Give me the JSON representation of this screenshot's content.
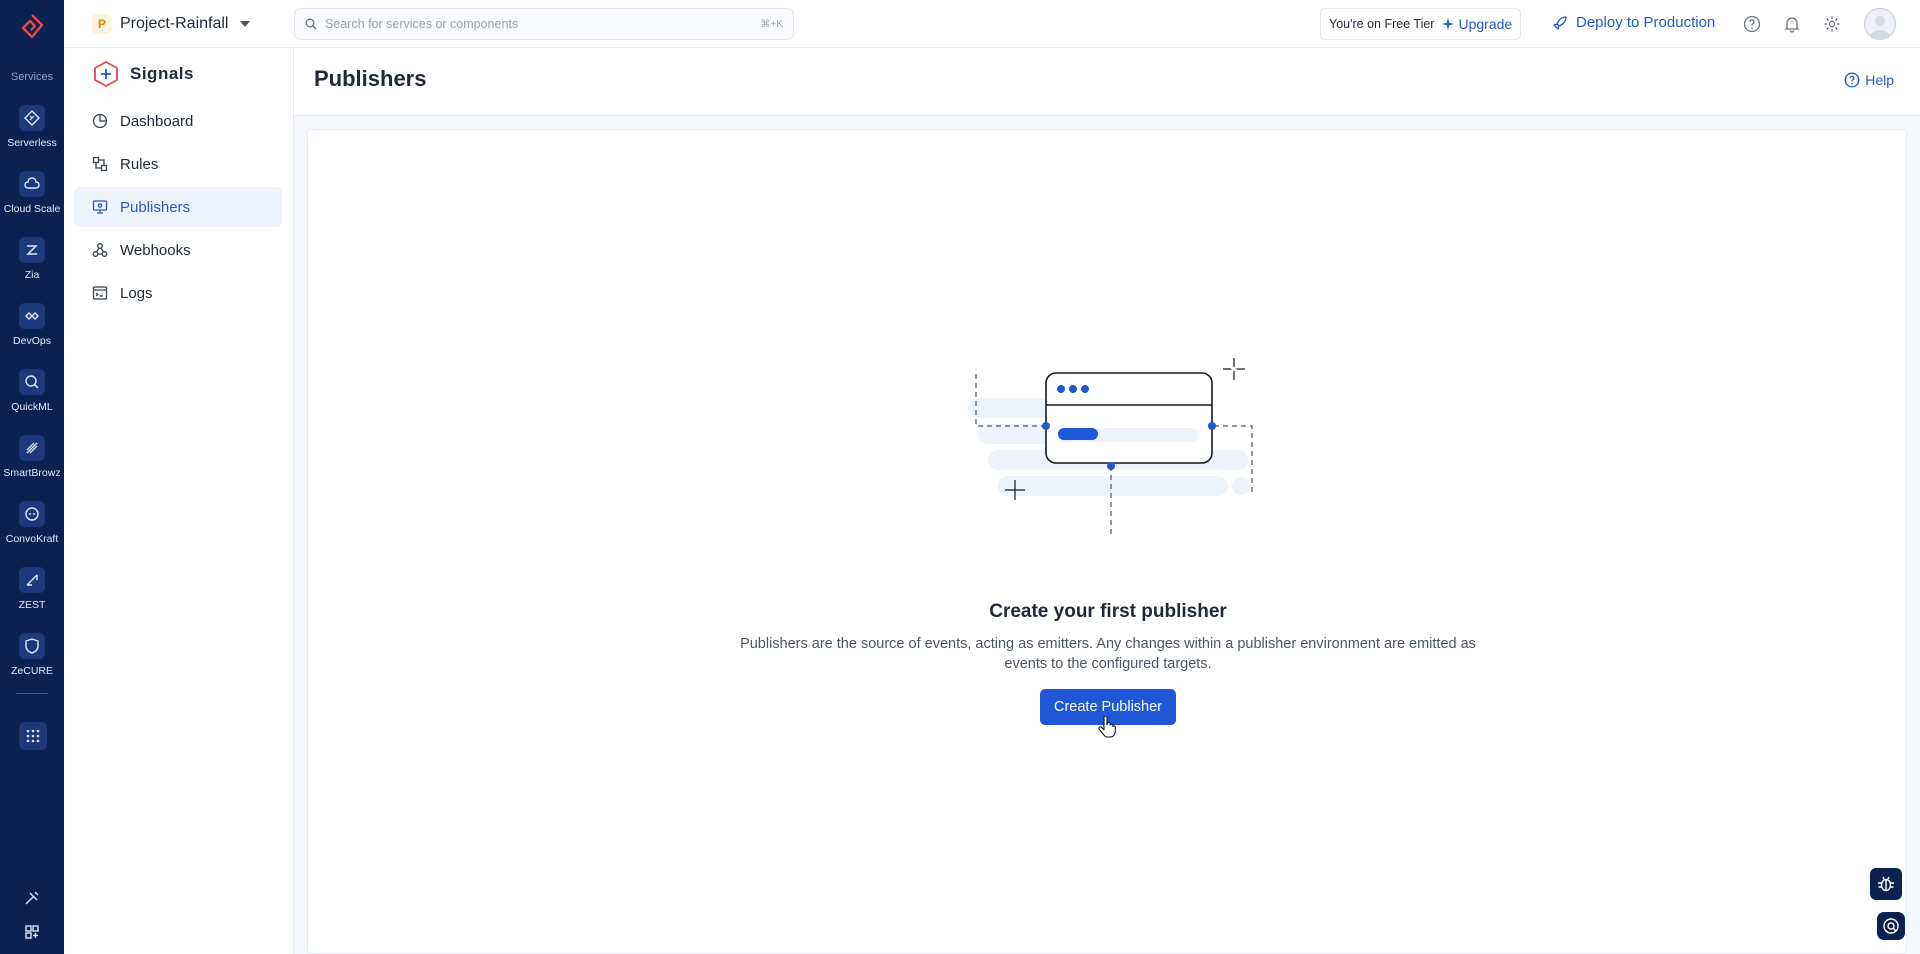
{
  "rail": {
    "section_label": "Services",
    "items": [
      {
        "label": "Serverless",
        "icon": "serverless-icon"
      },
      {
        "label": "Cloud Scale",
        "icon": "cloud-scale-icon"
      },
      {
        "label": "Zia",
        "icon": "zia-icon"
      },
      {
        "label": "DevOps",
        "icon": "devops-icon"
      },
      {
        "label": "QuickML",
        "icon": "quickml-icon"
      },
      {
        "label": "SmartBrowz",
        "icon": "smartbrowz-icon"
      },
      {
        "label": "ConvoKraft",
        "icon": "convokraft-icon"
      },
      {
        "label": "ZEST",
        "icon": "zest-icon"
      },
      {
        "label": "ZeCURE",
        "icon": "zecure-icon"
      }
    ]
  },
  "topbar": {
    "project_initial": "P",
    "project_name": "Project-Rainfall",
    "search_placeholder": "Search for services or components",
    "search_shortcut": "⌘+K",
    "tier_text": "You're on Free Tier",
    "upgrade_label": "Upgrade",
    "deploy_label": "Deploy to Production"
  },
  "sidebar": {
    "service_title": "Signals",
    "items": [
      {
        "label": "Dashboard",
        "icon": "dashboard-icon"
      },
      {
        "label": "Rules",
        "icon": "rules-icon"
      },
      {
        "label": "Publishers",
        "icon": "publishers-icon",
        "active": true
      },
      {
        "label": "Webhooks",
        "icon": "webhooks-icon"
      },
      {
        "label": "Logs",
        "icon": "logs-icon"
      }
    ]
  },
  "main": {
    "page_title": "Publishers",
    "help_label": "Help",
    "empty_title": "Create your first publisher",
    "empty_desc": "Publishers are the source of events, acting as emitters. Any changes within a publisher environment are emitted as events to the configured targets.",
    "cta_label": "Create Publisher"
  },
  "colors": {
    "rail_bg": "#0b2251",
    "accent": "#2459c9",
    "cta_bg": "#1f57d6"
  }
}
